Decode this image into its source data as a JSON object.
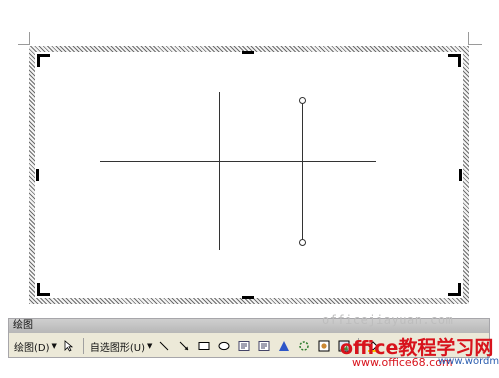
{
  "toolbar": {
    "title": "绘图",
    "draw_menu_label": "绘图(D)",
    "autoshapes_label": "自选图形(U)"
  },
  "icons": [
    "select-arrow-icon",
    "line-icon",
    "arrow-icon",
    "rectangle-icon",
    "oval-icon",
    "textbox-icon",
    "vertical-textbox-icon",
    "wordart-icon",
    "diagram-icon",
    "clipart-icon",
    "picture-icon",
    "fill-color-icon"
  ],
  "watermark": {
    "line1": "officejiayuan.com",
    "line2": "office教程学习网",
    "line3": "www.office68.com",
    "line4": "www.wordm"
  }
}
